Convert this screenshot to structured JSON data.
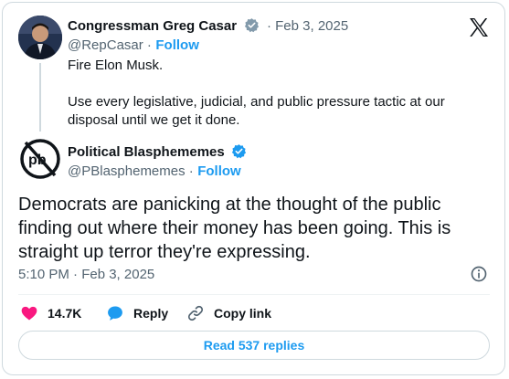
{
  "quoted": {
    "name": "Congressman Greg Casar",
    "date": "· Feb 3, 2025",
    "handle": "@RepCasar ·",
    "follow": "Follow",
    "line1": "Fire Elon Musk.",
    "line2": "Use every legislative, judicial, and public pressure tactic at our",
    "line3": "disposal until we get it done."
  },
  "post": {
    "name": "Political Blasphememes",
    "handle": "@PBlasphememes ·",
    "follow": "Follow",
    "text": "Democrats are panicking at the thought of the public finding out where their money has been going. This is straight up terror they're expressing.",
    "meta": "5:10 PM · Feb 3, 2025"
  },
  "actions": {
    "likes": "14.7K",
    "reply": "Reply",
    "copy_link": "Copy link"
  },
  "replies_button": "Read 537 replies",
  "colors": {
    "like": "#f91880",
    "link": "#1d9bf0",
    "verified": "#1d9bf0",
    "muted": "#536471"
  },
  "icons": [
    "x-logo-icon",
    "verified-badge-icon",
    "info-icon",
    "heart-icon",
    "reply-bubble-icon",
    "link-icon"
  ]
}
